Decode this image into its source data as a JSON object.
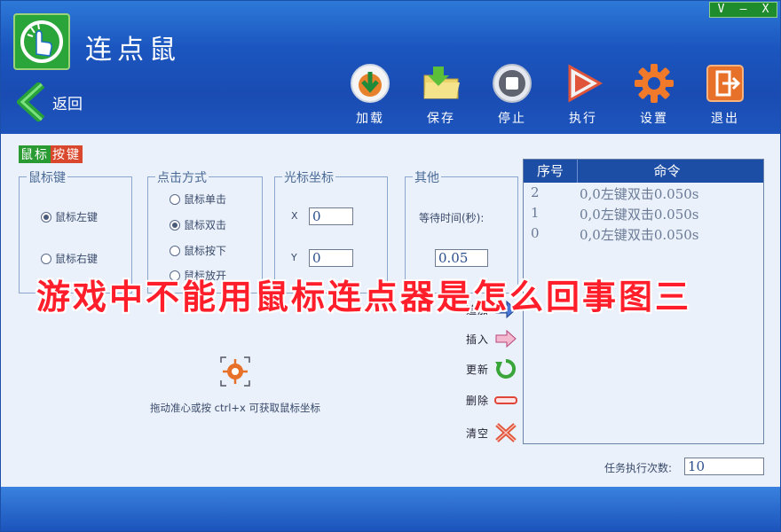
{
  "app": {
    "title": "连点鼠"
  },
  "window_controls": [
    "V",
    "–",
    "X"
  ],
  "nav": {
    "back_label": "返回"
  },
  "toolbar": [
    {
      "label": "加载",
      "icon": "load-icon"
    },
    {
      "label": "保存",
      "icon": "folder-save-icon"
    },
    {
      "label": "停止",
      "icon": "stop-icon"
    },
    {
      "label": "执行",
      "icon": "play-icon"
    },
    {
      "label": "设置",
      "icon": "gear-icon"
    },
    {
      "label": "退出",
      "icon": "exit-icon"
    }
  ],
  "tab": {
    "part1": "鼠标",
    "part2": "按键"
  },
  "mouse_key": {
    "title": "鼠标键",
    "options": [
      "鼠标左键",
      "鼠标右键"
    ],
    "selected": 0
  },
  "click_mode": {
    "title": "点击方式",
    "options": [
      "鼠标单击",
      "鼠标双击",
      "鼠标按下",
      "鼠标放开"
    ],
    "selected": 1
  },
  "cursor": {
    "title": "光标坐标",
    "x_label": "X",
    "y_label": "Y",
    "x_value": "0",
    "y_value": "0"
  },
  "other": {
    "title": "其他",
    "wait_label": "等待时间(秒):",
    "wait_value": "0.05"
  },
  "crosshair_hint": "拖动准心或按 ctrl+x 可获取鼠标坐标",
  "actions": [
    "追加",
    "插入",
    "更新",
    "删除",
    "清空"
  ],
  "commands": {
    "headers": [
      "序号",
      "命令"
    ],
    "rows": [
      {
        "index": "2",
        "cmd": "0,0左键双击0.050s"
      },
      {
        "index": "1",
        "cmd": "0,0左键双击0.050s"
      },
      {
        "index": "0",
        "cmd": "0,0左键双击0.050s"
      }
    ]
  },
  "task_count": {
    "label": "任务执行次数:",
    "value": "10"
  },
  "overlay_text": "游戏中不能用鼠标连点器是怎么回事图三",
  "colors": {
    "header_blue": "#1a4fb8",
    "tab_green": "#2a9a32",
    "tab_red": "#d9482d",
    "overlay_red": "#ff1e2a"
  }
}
